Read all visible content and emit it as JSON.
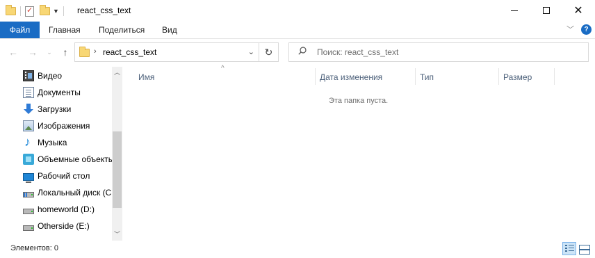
{
  "window": {
    "title": "react_css_text"
  },
  "ribbon": {
    "tabs": [
      {
        "label": "Файл"
      },
      {
        "label": "Главная"
      },
      {
        "label": "Поделиться"
      },
      {
        "label": "Вид"
      }
    ]
  },
  "address": {
    "crumb": "react_css_text"
  },
  "search": {
    "placeholder": "Поиск: react_css_text"
  },
  "sidebar": {
    "items": [
      {
        "label": "Видео",
        "icon": "video-icon"
      },
      {
        "label": "Документы",
        "icon": "documents-icon"
      },
      {
        "label": "Загрузки",
        "icon": "downloads-icon"
      },
      {
        "label": "Изображения",
        "icon": "pictures-icon"
      },
      {
        "label": "Музыка",
        "icon": "music-icon"
      },
      {
        "label": "Объемные объекты",
        "icon": "3d-objects-icon"
      },
      {
        "label": "Рабочий стол",
        "icon": "desktop-icon"
      },
      {
        "label": "Локальный диск (C:)",
        "icon": "system-drive-icon"
      },
      {
        "label": "homeworld (D:)",
        "icon": "drive-icon"
      },
      {
        "label": "Otherside (E:)",
        "icon": "drive-icon"
      }
    ]
  },
  "columns": {
    "name": "Имя",
    "modified": "Дата изменения",
    "type": "Тип",
    "size": "Размер"
  },
  "content": {
    "empty_message": "Эта папка пуста."
  },
  "status": {
    "items_count": "Элементов: 0"
  },
  "colors": {
    "accent": "#1a6cc4",
    "header_text": "#4c607a"
  }
}
